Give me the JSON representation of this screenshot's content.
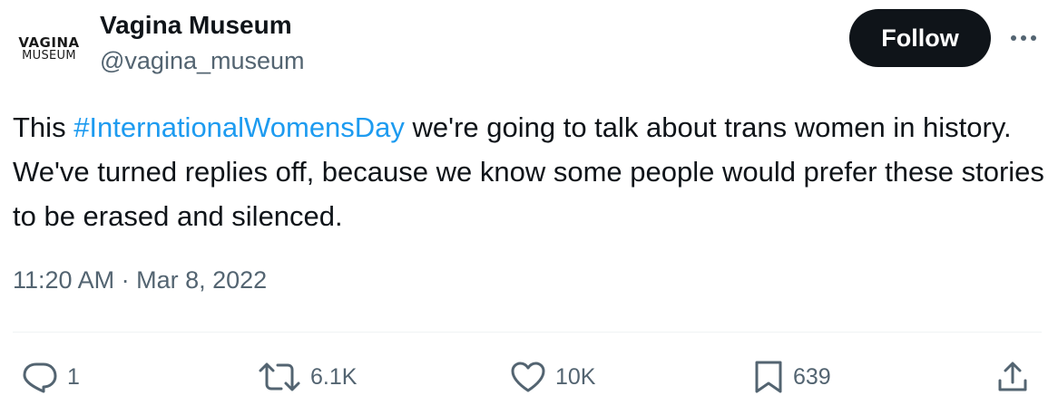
{
  "author": {
    "avatar_line1": "VAGINA",
    "avatar_line2": "MUSEUM",
    "display_name": "Vagina Museum",
    "handle": "@vagina_museum"
  },
  "follow_button": {
    "label": "Follow"
  },
  "more_menu": {
    "icon": "more-horizontal-icon"
  },
  "tweet": {
    "text_before": "This ",
    "hashtag": "#InternationalWomensDay",
    "text_after": " we're going to talk about trans women in history. We've turned replies off, because we know some people would prefer these stories to be erased and silenced.",
    "time": "11:20 AM",
    "separator": " · ",
    "date": "Mar 8, 2022"
  },
  "actions": {
    "reply": {
      "icon": "reply-icon",
      "count": "1"
    },
    "retweet": {
      "icon": "retweet-icon",
      "count": "6.1K"
    },
    "like": {
      "icon": "heart-icon",
      "count": "10K"
    },
    "bookmark": {
      "icon": "bookmark-icon",
      "count": "639"
    },
    "share": {
      "icon": "share-icon"
    }
  },
  "colors": {
    "text": "#0f1419",
    "secondary": "#536471",
    "link": "#1d9bf0",
    "button_bg": "#0f1419",
    "divider": "#eff3f4"
  }
}
